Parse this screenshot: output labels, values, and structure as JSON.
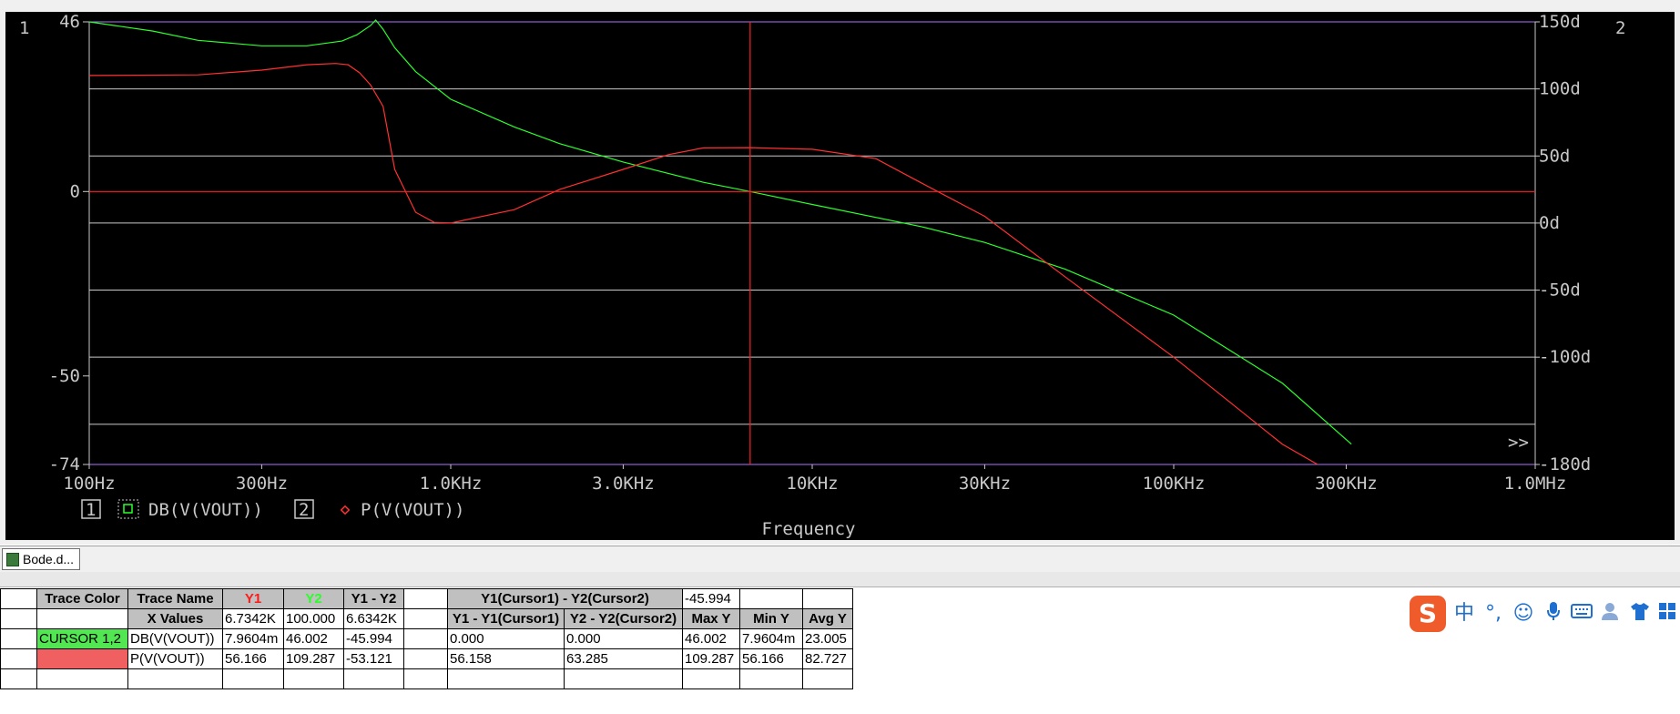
{
  "plot": {
    "left_axis_id": "1",
    "right_axis_id": "2",
    "y1_ticks": [
      "46",
      "0",
      "-50",
      "-74"
    ],
    "y2_ticks": [
      "150d",
      "100d",
      "50d",
      "0d",
      "-50d",
      "-100d",
      "-180d"
    ],
    "x_ticks": [
      "100Hz",
      "300Hz",
      "1.0KHz",
      "3.0KHz",
      "10KHz",
      "30KHz",
      "100KHz",
      "300KHz",
      "1.0MHz"
    ],
    "xlabel": "Frequency",
    "more_indicator": ">>",
    "legend": [
      {
        "axis": "1",
        "name": "DB(V(VOUT))",
        "color": "#2aff2a",
        "marker": "square"
      },
      {
        "axis": "2",
        "name": "P(V(VOUT))",
        "color": "#ff3030",
        "marker": "diamond"
      }
    ],
    "cursor_frequency": "6.7342K"
  },
  "chart_data": {
    "type": "line",
    "title": "",
    "xlabel": "Frequency",
    "x_scale": "log",
    "xlim": [
      100,
      1000000
    ],
    "ylim_left": [
      -74,
      46
    ],
    "ylim_right": [
      -180,
      150
    ],
    "grid": true,
    "series": [
      {
        "name": "DB(V(VOUT))",
        "axis": "left",
        "x": [
          100,
          150,
          200,
          300,
          400,
          500,
          550,
          600,
          620,
          650,
          700,
          800,
          1000,
          1500,
          2000,
          3000,
          5000,
          6734,
          10000,
          20000,
          30000,
          50000,
          100000,
          200000,
          310000
        ],
        "y": [
          46.0,
          43.5,
          41.0,
          39.5,
          39.5,
          40.8,
          42.5,
          45.0,
          46.5,
          44.0,
          39.0,
          32.5,
          25.0,
          17.5,
          13.0,
          8.0,
          2.5,
          0.0,
          -3.5,
          -9.5,
          -13.8,
          -21.0,
          -33.5,
          -52.0,
          -68.5
        ]
      },
      {
        "name": "P(V(VOUT))",
        "axis": "right",
        "x": [
          100,
          200,
          300,
          400,
          480,
          520,
          560,
          600,
          650,
          700,
          800,
          900,
          1000,
          1500,
          2000,
          3000,
          4000,
          5000,
          6734,
          10000,
          15000,
          20000,
          30000,
          50000,
          100000,
          200000,
          250000
        ],
        "y": [
          110.0,
          110.5,
          114.0,
          118.0,
          119.0,
          118.0,
          112.0,
          103.0,
          87.0,
          40.0,
          8.0,
          0.5,
          0.0,
          10.0,
          25.0,
          40.0,
          51.0,
          56.0,
          56.2,
          55.0,
          48.0,
          30.0,
          5.0,
          -40.0,
          -100.0,
          -165.0,
          -180.0
        ]
      }
    ]
  },
  "doc_tab": {
    "label": "Bode.d..."
  },
  "table": {
    "row1": {
      "trace_color_header": "Trace Color",
      "trace_name_header": "Trace Name",
      "y1_header": "Y1",
      "y2_header": "Y2",
      "diff_header": "Y1 - Y2",
      "cursor_diff_header": "Y1(Cursor1) - Y2(Cursor2)",
      "cursor_diff_value": "-45.994"
    },
    "row2": {
      "x_values_label": "X Values",
      "y1": "6.7342K",
      "y2": "100.000",
      "diff": "6.6342K",
      "y1_minus_cursor_header": "Y1 - Y1(Cursor1)",
      "y2_minus_cursor_header": "Y2 - Y2(Cursor2)",
      "max_header": "Max Y",
      "min_header": "Min Y",
      "avg_header": "Avg Y"
    },
    "row3": {
      "trace_color": "CURSOR 1,2",
      "trace_name": "DB(V(VOUT))",
      "y1": "7.9604m",
      "y2": "46.002",
      "diff": "-45.994",
      "y1_minus_cursor": "0.000",
      "y2_minus_cursor": "0.000",
      "max": "46.002",
      "min": "7.9604m",
      "avg": "23.005"
    },
    "row4": {
      "trace_name": "P(V(VOUT))",
      "y1": "56.166",
      "y2": "109.287",
      "diff": "-53.121",
      "y1_minus_cursor": "56.158",
      "y2_minus_cursor": "63.285",
      "max": "109.287",
      "min": "56.166",
      "avg": "82.727"
    }
  },
  "ime": {
    "logo": "S",
    "chinese_mode": "中",
    "punctuation": "°,"
  }
}
